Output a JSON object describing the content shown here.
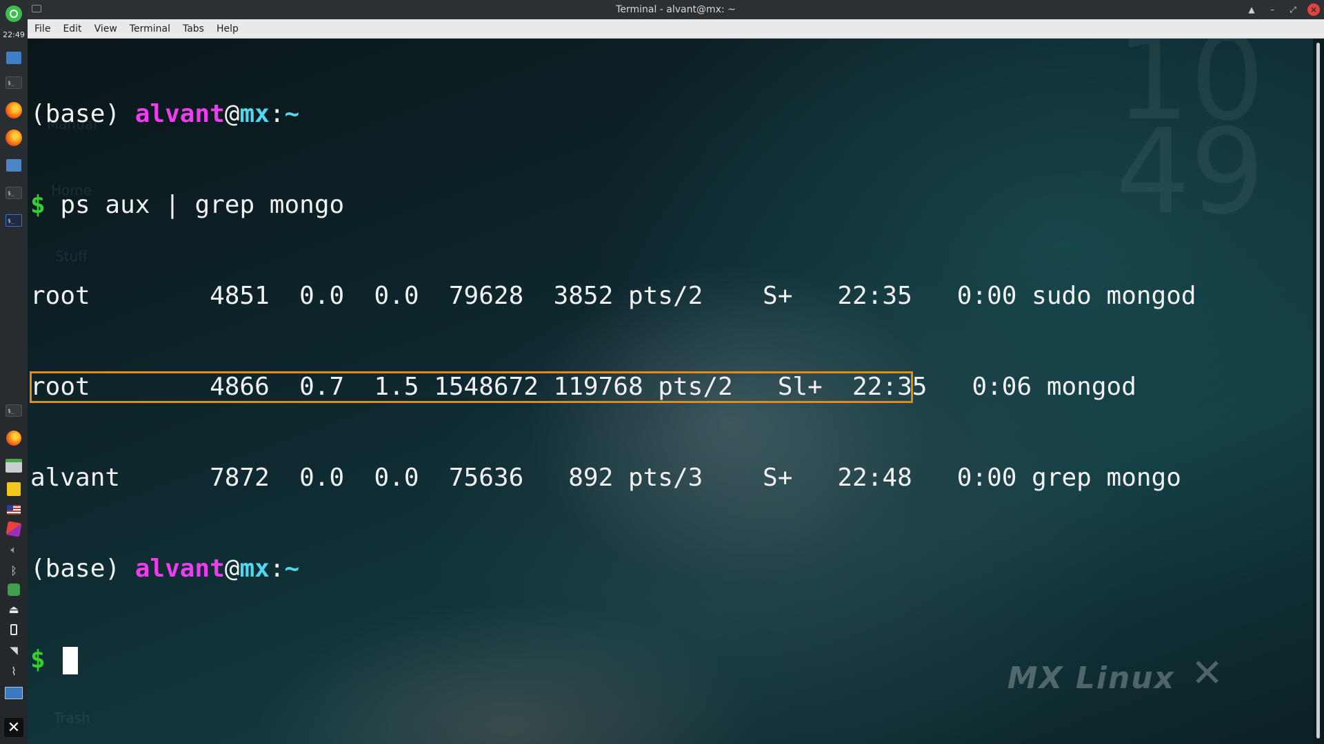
{
  "window": {
    "title": "Terminal - alvant@mx: ~"
  },
  "panel": {
    "clock": "22:49",
    "top_items": [
      "mx-logo-icon",
      "home-icon",
      "terminal-icon",
      "firefox-icon",
      "firefox-icon",
      "downloads-icon",
      "terminal-icon",
      "terminal-icon"
    ],
    "bottom_items": [
      "terminal-icon",
      "firefox-icon",
      "file-manager-icon",
      "notes-icon",
      "keyboard-layout-flag-icon",
      "package-icon",
      "volume-icon",
      "bluetooth-icon",
      "updater-icon",
      "eject-icon",
      "battery-icon",
      "network-icon",
      "clip-icon",
      "show-desktop-icon",
      "mx-x-icon"
    ]
  },
  "menu": {
    "items": [
      "File",
      "Edit",
      "View",
      "Terminal",
      "Tabs",
      "Help"
    ]
  },
  "terminal": {
    "prompt_env": "(base)",
    "prompt_user": "alvant",
    "prompt_at": "@",
    "prompt_host": "mx",
    "prompt_sep": ":",
    "prompt_dir": "~",
    "prompt_dollar": "$",
    "command": "ps aux | grep mongo",
    "rows": [
      "root        4851  0.0  0.0  79628  3852 pts/2    S+   22:35   0:00 sudo mongod",
      "root        4866  0.7  1.5 1548672 119768 pts/2   Sl+  22:35   0:06 mongod",
      "alvant      7872  0.0  0.0  75636   892 pts/3    S+   22:48   0:00 grep mongo"
    ],
    "highlight_row": 1
  },
  "desktop": {
    "icon_labels": [
      "Manual",
      "Home",
      "Stuff",
      "Trash"
    ],
    "conky_clock": "10\n49",
    "logo_text": "MX Linux"
  },
  "colors": {
    "user": "#f03cf0",
    "host": "#4fd9f0",
    "dollar": "#35d02f",
    "highlight": "#e58a18",
    "close_button": "#e0443c"
  }
}
